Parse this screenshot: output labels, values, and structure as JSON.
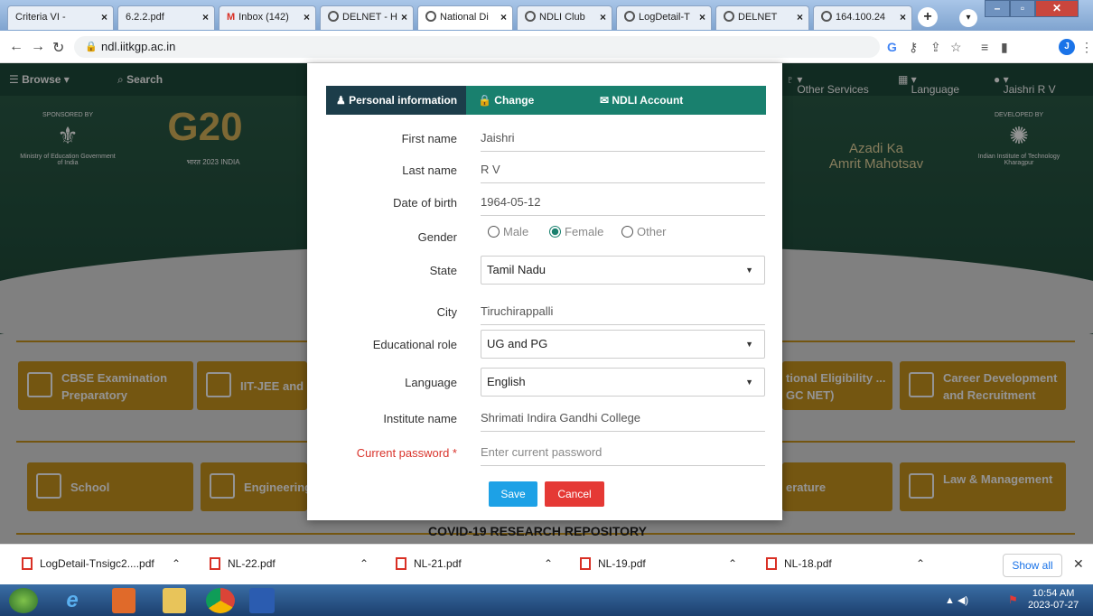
{
  "browser": {
    "tabs": [
      {
        "label": "Criteria VI -"
      },
      {
        "label": "6.2.2.pdf"
      },
      {
        "label": "Inbox (142)"
      },
      {
        "label": "DELNET - H"
      },
      {
        "label": "National Di"
      },
      {
        "label": "NDLI Club"
      },
      {
        "label": "LogDetail-T"
      },
      {
        "label": "DELNET"
      },
      {
        "label": "164.100.24"
      }
    ],
    "close_glyph": "×",
    "new_tab_glyph": "+",
    "url": "ndl.iitkgp.ac.in"
  },
  "site": {
    "nav": {
      "browse": "Browse",
      "search": "Search",
      "other_services": "Other Services",
      "language": "Language",
      "user": "Jaishri R V"
    },
    "logos": {
      "sponsor_label": "SPONSORED BY",
      "sponsor_name": "Ministry of Education Government of India",
      "g20": "G20",
      "g20_sub": "भारत 2023 INDIA",
      "azadi_line1": "Azadi Ka",
      "azadi_line2": "Amrit Mahotsav",
      "developer_label": "DEVELOPED BY",
      "developer_name": "Indian Institute of Technology Kharagpur"
    },
    "categories_row1": [
      {
        "label": "CBSE Examination Preparatory"
      },
      {
        "label": "IIT-JEE and"
      },
      {
        "label": "tional Eligibility ... GC NET)"
      },
      {
        "label": "Career Development and Recruitment"
      }
    ],
    "categories_row2": [
      {
        "label": "School"
      },
      {
        "label": "Engineering"
      },
      {
        "label": "erature"
      },
      {
        "label": "Law & Management"
      }
    ],
    "covid_heading": "COVID-19 RESEARCH REPOSITORY"
  },
  "modal": {
    "tabs": [
      {
        "label": "Personal information"
      },
      {
        "label": "Change password"
      },
      {
        "label": "NDLI Account"
      }
    ],
    "fields": {
      "first_name": {
        "label": "First name",
        "value": "Jaishri"
      },
      "last_name": {
        "label": "Last name",
        "value": "R V"
      },
      "dob": {
        "label": "Date of birth",
        "value": "1964-05-12"
      },
      "gender": {
        "label": "Gender",
        "options": [
          "Male",
          "Female",
          "Other"
        ],
        "selected": "Female"
      },
      "state": {
        "label": "State",
        "value": "Tamil Nadu"
      },
      "city": {
        "label": "City",
        "value": "Tiruchirappalli"
      },
      "edu_role": {
        "label": "Educational role",
        "value": "UG and PG"
      },
      "language": {
        "label": "Language",
        "value": "English"
      },
      "institute": {
        "label": "Institute name",
        "value": "Shrimati Indira Gandhi College"
      },
      "current_password": {
        "label": "Current password *",
        "placeholder": "Enter current password"
      }
    },
    "save_label": "Save",
    "cancel_label": "Cancel",
    "colors": {
      "tab_bar": "#19806e",
      "tab_active": "#1c3d4a",
      "save": "#1da1e6",
      "cancel": "#e53935"
    }
  },
  "downloads": {
    "items": [
      {
        "name": "LogDetail-Tnsigc2....pdf"
      },
      {
        "name": "NL-22.pdf"
      },
      {
        "name": "NL-21.pdf"
      },
      {
        "name": "NL-19.pdf"
      },
      {
        "name": "NL-18.pdf"
      }
    ],
    "show_all": "Show all"
  },
  "taskbar": {
    "time": "10:54 AM",
    "date": "2023-07-27"
  }
}
